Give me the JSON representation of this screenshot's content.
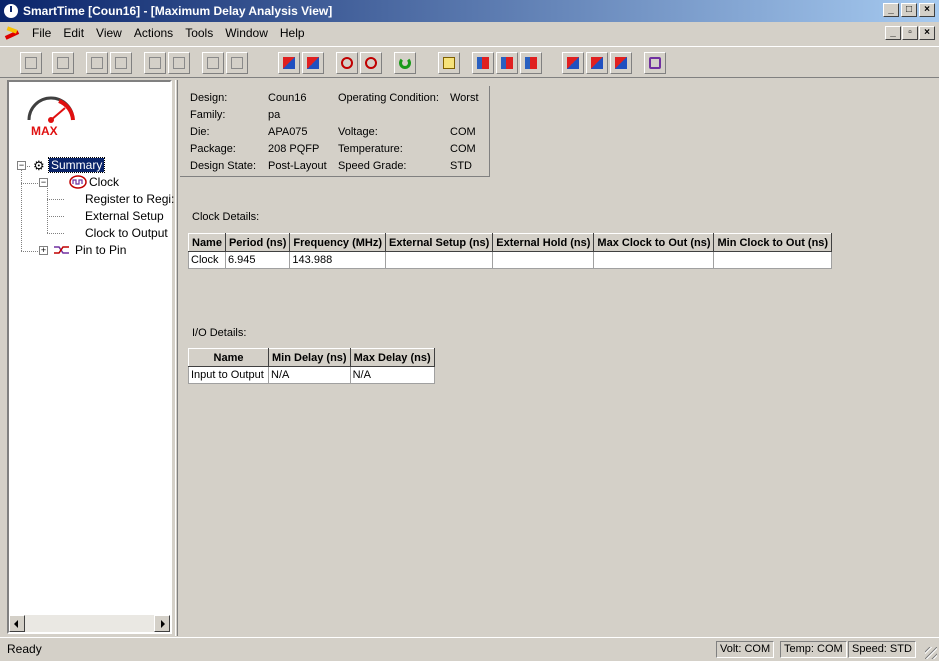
{
  "window": {
    "title": "SmartTime [Coun16] - [Maximum Delay Analysis View]"
  },
  "menu": [
    "File",
    "Edit",
    "View",
    "Actions",
    "Tools",
    "Window",
    "Help"
  ],
  "tree": {
    "gauge_label": "MAX",
    "summary": "Summary",
    "clock": "Clock",
    "clock_children": [
      "Register to Regi:",
      "External Setup",
      "Clock to Output"
    ],
    "pin_to_pin": "Pin to Pin"
  },
  "design": {
    "design_key": "Design:",
    "design_val": "Coun16",
    "family_key": "Family:",
    "family_val": "pa",
    "die_key": "Die:",
    "die_val": "APA075",
    "package_key": "Package:",
    "package_val": "208 PQFP",
    "state_key": "Design State:",
    "state_val": "Post-Layout",
    "opcond_key": "Operating Condition:",
    "opcond_val": "Worst",
    "voltage_key": "Voltage:",
    "voltage_val": "COM",
    "temp_key": "Temperature:",
    "temp_val": "COM",
    "speed_key": "Speed Grade:",
    "speed_val": "STD"
  },
  "clock_details": {
    "label": "Clock Details:",
    "headers": [
      "Name",
      "Period (ns)",
      "Frequency (MHz)",
      "External Setup (ns)",
      "External Hold (ns)",
      "Max Clock to Out (ns)",
      "Min Clock to Out (ns)"
    ],
    "row": [
      "Clock",
      "6.945",
      "143.988",
      "",
      "",
      "",
      ""
    ]
  },
  "io_details": {
    "label": "I/O Details:",
    "headers": [
      "Name",
      "Min Delay (ns)",
      "Max Delay (ns)"
    ],
    "row": [
      "Input to Output",
      "N/A",
      "N/A"
    ]
  },
  "status": {
    "ready": "Ready",
    "volt": "Volt: COM",
    "temp": "Temp: COM",
    "speed": "Speed: STD"
  }
}
